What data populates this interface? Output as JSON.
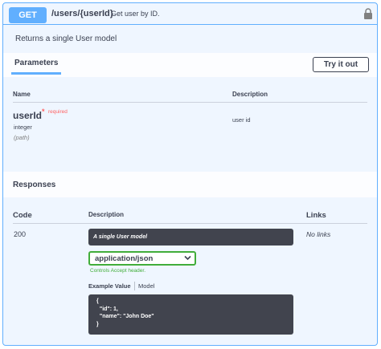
{
  "colors": {
    "get_accent": "#61affe",
    "panel_bg": "#eff6ff",
    "text": "#3b4151",
    "required": "#ff6060",
    "select_border": "#41ad3a",
    "code_bg": "#41444e"
  },
  "operation": {
    "method": "GET",
    "path": "/users/{userId}",
    "summary": "Get user by ID.",
    "lock_icon": "lock-icon",
    "description": "Returns a single User model"
  },
  "parameters": {
    "tab_title": "Parameters",
    "try_button": "Try it out",
    "columns": {
      "name": "Name",
      "description": "Description"
    },
    "items": [
      {
        "name": "userId",
        "required_mark": "*",
        "required_label": "required",
        "type": "integer",
        "in": "(path)",
        "description": "user id"
      }
    ]
  },
  "responses": {
    "title": "Responses",
    "columns": {
      "code": "Code",
      "description": "Description",
      "links": "Links"
    },
    "items": [
      {
        "code": "200",
        "description": "A single User model",
        "links": "No links",
        "media_type": "application/json",
        "media_hint": "Controls Accept header.",
        "example_tab": "Example Value",
        "model_tab": "Model",
        "example_lines": [
          "{",
          "  \"id\": 1,",
          "  \"name\": \"John Doe\"",
          "}"
        ]
      }
    ]
  }
}
